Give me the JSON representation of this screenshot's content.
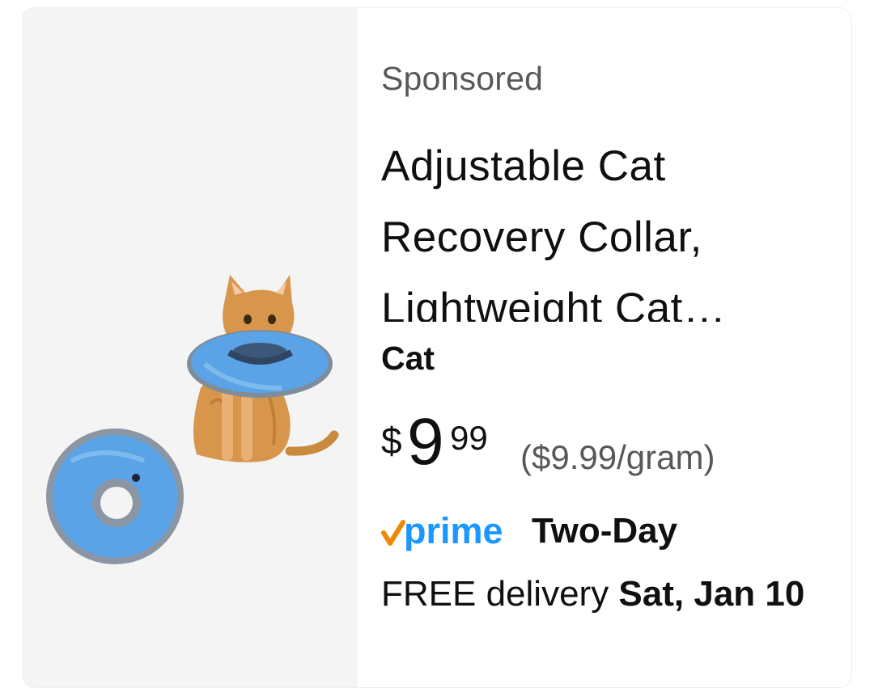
{
  "listing": {
    "sponsored_label": "Sponsored",
    "title_lines": [
      "Adjustable Cat",
      "Recovery Collar,",
      "Lightweight Cat…"
    ],
    "brand": "Cat",
    "price": {
      "symbol": "$",
      "whole": "9",
      "fraction": "99",
      "unit_price": "($9.99/gram)"
    },
    "prime": {
      "logo_text": "prime",
      "label": "Two-Day"
    },
    "delivery": {
      "prefix": "FREE delivery ",
      "date": "Sat, Jan 10"
    },
    "image": {
      "icon": "cat-recovery-collar-image",
      "collar_color": "#5aa3e6",
      "background": "#f4f4f4"
    }
  },
  "colors": {
    "text_primary": "#0f1111",
    "text_secondary": "#565959",
    "prime_blue": "#1a98ff",
    "prime_check": "#f08804"
  }
}
